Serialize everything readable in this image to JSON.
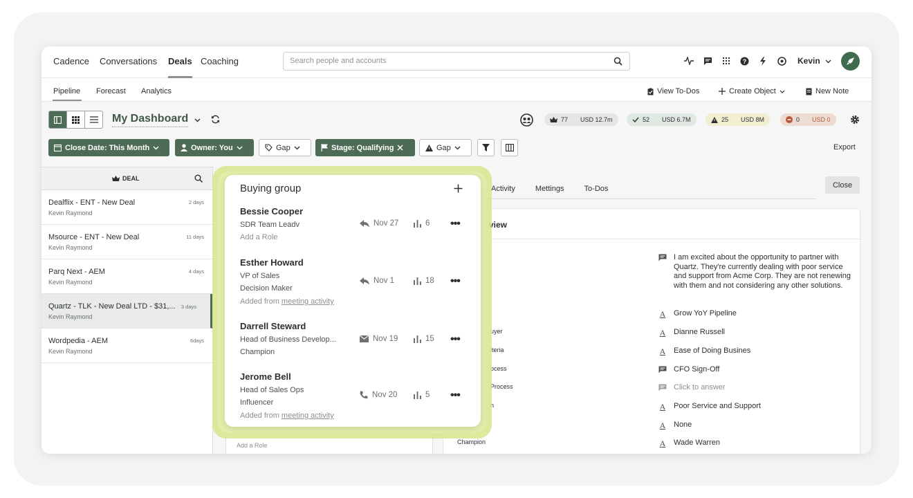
{
  "topnav": {
    "items": [
      "Cadence",
      "Conversations",
      "Deals",
      "Coaching"
    ],
    "search_placeholder": "Search people and accounts",
    "user": "Kevin"
  },
  "subnav": {
    "tabs": [
      "Pipeline",
      "Forecast",
      "Analytics"
    ],
    "view_todos": "View To-Dos",
    "create_object": "Create Object",
    "new_note": "New Note"
  },
  "toolbar": {
    "dashboard_title": "My Dashboard",
    "stats": [
      {
        "count": "77",
        "amount": "USD 12.7m",
        "bg": "#e4e5e5"
      },
      {
        "count": "52",
        "amount": "USD 6.7M",
        "bg": "#dfe8e1"
      },
      {
        "count": "25",
        "amount": "USD 8M",
        "bg": "#f1eed2"
      },
      {
        "count": "0",
        "amount": "USD 0",
        "bg": "#ecdcd2"
      }
    ],
    "filters": {
      "close_date": "Close Date: This Month",
      "owner": "Owner: You",
      "gap1": "Gap",
      "stage": "Stage: Qualifying",
      "gap2": "Gap"
    },
    "export": "Export"
  },
  "deals": {
    "header": "DEAL",
    "rows": [
      {
        "name": "Dealflix - ENT - New Deal",
        "owner": "Kevin Raymond",
        "age": "2 days"
      },
      {
        "name": "Msource - ENT - New Deal",
        "owner": "Kevin Raymond",
        "age": "11 days"
      },
      {
        "name": "Parq Next - AEM",
        "owner": "Kevin Raymond",
        "age": "4 days"
      },
      {
        "name": "Quartz - TLK - New Deal LTD - $31,...",
        "owner": "Kevin Raymond",
        "age": "3 days"
      },
      {
        "name": "Wordpedia - AEM",
        "owner": "Kevin Raymond",
        "age": "6days"
      }
    ]
  },
  "middle": {
    "add_role": "Add a Role"
  },
  "detail": {
    "tabs": [
      "Activity",
      "Mettings",
      "To-Dos"
    ],
    "close": "Close",
    "overview_title": "view",
    "left_labels": [
      "uyer",
      "iteria",
      "ocess",
      "Process",
      "n",
      "Champion"
    ],
    "right_items": [
      {
        "icon": "comment-icon",
        "text": "I am excited about the opportunity to partner with Quartz. They're currently dealing with poor service and support from Acme Corp. They are not renewing with them and not considering any other solutions."
      },
      {
        "icon": "text-a-icon",
        "text": "Grow YoY Pipeline"
      },
      {
        "icon": "text-a-icon",
        "text": "Dianne Russell"
      },
      {
        "icon": "text-a-icon",
        "text": "Ease of Doing Busines"
      },
      {
        "icon": "comment-icon",
        "text": "CFO Sign-Off"
      },
      {
        "icon": "comment-icon",
        "text": "Click to answer"
      },
      {
        "icon": "text-a-icon",
        "text": "Poor Service and Support"
      },
      {
        "icon": "text-a-icon",
        "text": "None"
      },
      {
        "icon": "text-a-icon",
        "text": "Wade Warren"
      }
    ]
  },
  "buying_group": {
    "title": "Buying group",
    "people": [
      {
        "name": "Bessie Cooper",
        "title": "SDR Team Leadv",
        "role": "",
        "note": "Add a Role",
        "note_link": "",
        "activity_icon": "reply-icon",
        "date": "Nov 27",
        "count": "6"
      },
      {
        "name": "Esther Howard",
        "title": "VP of Sales",
        "role": "Decision Maker",
        "note": "Added from ",
        "note_link": "meeting activity",
        "activity_icon": "reply-icon",
        "date": "Nov 1",
        "count": "18"
      },
      {
        "name": "Darrell Steward",
        "title": "Head of Business Develop...",
        "role": "Champion",
        "note": "",
        "note_link": "",
        "activity_icon": "mail-icon",
        "date": "Nov 19",
        "count": "15"
      },
      {
        "name": "Jerome Bell",
        "title": "Head of Sales Ops",
        "role": "Influencer",
        "note": "Added from ",
        "note_link": "meeting activity",
        "activity_icon": "phone-icon",
        "date": "Nov 20",
        "count": "5"
      }
    ]
  }
}
